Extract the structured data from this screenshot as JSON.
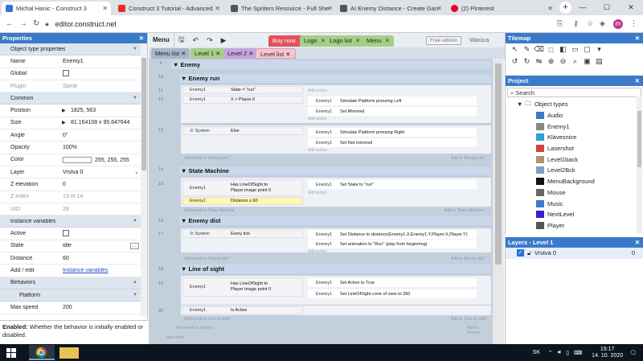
{
  "browser": {
    "tabs": [
      {
        "title": "Michal Hanic - Construct 3",
        "color": "#3a6fd8"
      },
      {
        "title": "Construct 3 Tutorial - Advanced",
        "color": "#e52d27"
      },
      {
        "title": "The Spriters Resource - Full She",
        "color": "#555555"
      },
      {
        "title": "AI Enemy Distance - Create Gan",
        "color": "#555555"
      },
      {
        "title": "(2) Pinterest",
        "color": "#e60023"
      }
    ],
    "url": "editor.construct.net",
    "profile_initial": "m"
  },
  "properties": {
    "title": "Properties",
    "rows": [
      {
        "type": "section",
        "label": "Object type properties"
      },
      {
        "label": "Name",
        "value": "Enemy1"
      },
      {
        "label": "Global",
        "value": "",
        "checkbox": true
      },
      {
        "label": "Plugin",
        "value": "Sprite",
        "grey": true
      },
      {
        "type": "section",
        "label": "Common"
      },
      {
        "label": "Position",
        "value": "1825, 563",
        "expander": true
      },
      {
        "label": "Size",
        "value": "81.164108 x 95.647644",
        "expander": true
      },
      {
        "label": "Angle",
        "value": "0°"
      },
      {
        "label": "Opacity",
        "value": "100%"
      },
      {
        "label": "Color",
        "value": "255, 255, 255",
        "swatch": true
      },
      {
        "label": "Layer",
        "value": "Vrstva 0",
        "dropdown": true
      },
      {
        "label": "Z elevation",
        "value": "0"
      },
      {
        "label": "Z index",
        "value": "13 of 14",
        "grey": true
      },
      {
        "label": "UID",
        "value": "28",
        "grey": true
      },
      {
        "type": "section",
        "label": "Instance variables"
      },
      {
        "label": "Active",
        "value": "",
        "checkbox": true
      },
      {
        "label": "State",
        "value": "idle",
        "ellipsis": true
      },
      {
        "label": "Distance",
        "value": "60"
      },
      {
        "label": "Add / edit",
        "value": "Instance variables",
        "link": true
      },
      {
        "type": "section",
        "label": "Behaviors"
      },
      {
        "type": "subsection",
        "label": "Platform"
      },
      {
        "label": "Max speed",
        "value": "200"
      }
    ],
    "help_bold": "Enabled:",
    "help_text": " Whether the behavior is initially enabled or disabled."
  },
  "toolbar": {
    "menu": "Menu",
    "tabs": [
      {
        "label": "Buy now",
        "bg": "#e0515a",
        "fg": "#ffffff"
      },
      {
        "label": "Logo",
        "bg": "#a5cf86",
        "fg": "#222222"
      },
      {
        "label": "Logo list",
        "bg": "#a5cf86",
        "fg": "#222222"
      },
      {
        "label": "Menu",
        "bg": "#a5cf86",
        "fg": "#222222"
      }
    ],
    "free_edition": "Free edition",
    "user": "Wacica"
  },
  "sheet_tabs": [
    {
      "label": "Menu list",
      "bg": "#aab6c8"
    },
    {
      "label": "Level 1",
      "bg": "#a5cf86"
    },
    {
      "label": "Level 2",
      "bg": "#c5a5e0"
    },
    {
      "label": "Level list",
      "bg": "#f7c6d0"
    }
  ],
  "events": {
    "top_group": "Enemy",
    "run_group": "Enemy run",
    "state_group": "State Machine",
    "dist_group": "Enemy dist",
    "los_group": "Line of sight",
    "enemy": "Enemy1",
    "system": "System",
    "c_state_run": "State = \"run\"",
    "c_x_player": "X > Player.X",
    "c_else": "Else",
    "a_simulate_left": "Simulate  Platform pressing Left",
    "a_mirrored": "Set Mirrored",
    "a_simulate_right": "Simulate  Platform pressing Right",
    "a_not_mirrored": "Set Not mirrored",
    "add_action": "Add action",
    "add_event_run": "Add event to 'Enemy run'",
    "add_to_run": "Add to 'Enemy run'",
    "c_has_los": "Has  LineOfSight to Player image point 0",
    "c_distance": "Distance ≤ 60",
    "a_state_run": "Set State to \"run\"",
    "add_event_state": "Add event to 'State Machine'",
    "add_to_state": "Add to 'State Machine'",
    "c_every_tick": "Every tick",
    "a_set_distance": "Set Distance to distance(Enemy1.X,Enemy1.Y,Player.X,Player.Y)",
    "a_set_anim": "Set animation to \"Run\" (play from beginning)",
    "add_event_dist": "Add event to 'Enemy dist'",
    "add_to_dist": "Add to 'Enemy dist'",
    "a_active_true": "Set Active to True",
    "a_cone": "Set  LineOfSight cone of view to 360",
    "c_is_active": "Is Active",
    "add_event_los": "Add event to 'Line of sight'",
    "add_to_los": "Add to 'Line of sight'",
    "add_event_enemy": "Add event to 'Enemy'",
    "add_to_enemy": "Add to 'Enemy'",
    "add_event": "Add event",
    "rows": [
      "9",
      "10",
      "11",
      "12",
      "13",
      "14",
      "15",
      "16",
      "17",
      "18",
      "19",
      "20"
    ]
  },
  "tilemap": {
    "title": "Tilemap"
  },
  "project": {
    "title": "Project",
    "search": "Search",
    "folder": "Object types",
    "items": [
      {
        "label": "Audio",
        "color": "#3a7ac9"
      },
      {
        "label": "Enemy1",
        "color": "#888888"
      },
      {
        "label": "Klávesnice",
        "color": "#2a9fd8"
      },
      {
        "label": "Lasershot",
        "color": "#d84040"
      },
      {
        "label": "Level1back",
        "color": "#b09070"
      },
      {
        "label": "Level2Bck",
        "color": "#7aa0c8"
      },
      {
        "label": "MenuBackground",
        "color": "#111111"
      },
      {
        "label": "Mouse",
        "color": "#666666"
      },
      {
        "label": "Music",
        "color": "#3a7ac9"
      },
      {
        "label": "NextLevel",
        "color": "#3a1fd0"
      },
      {
        "label": "Player",
        "color": "#555555"
      }
    ]
  },
  "layers": {
    "title": "Layers - Level 1",
    "layer": "Vrstva 0",
    "count": "0"
  },
  "taskbar": {
    "lang": "SK",
    "time": "19:17",
    "date": "14. 10. 2020"
  }
}
